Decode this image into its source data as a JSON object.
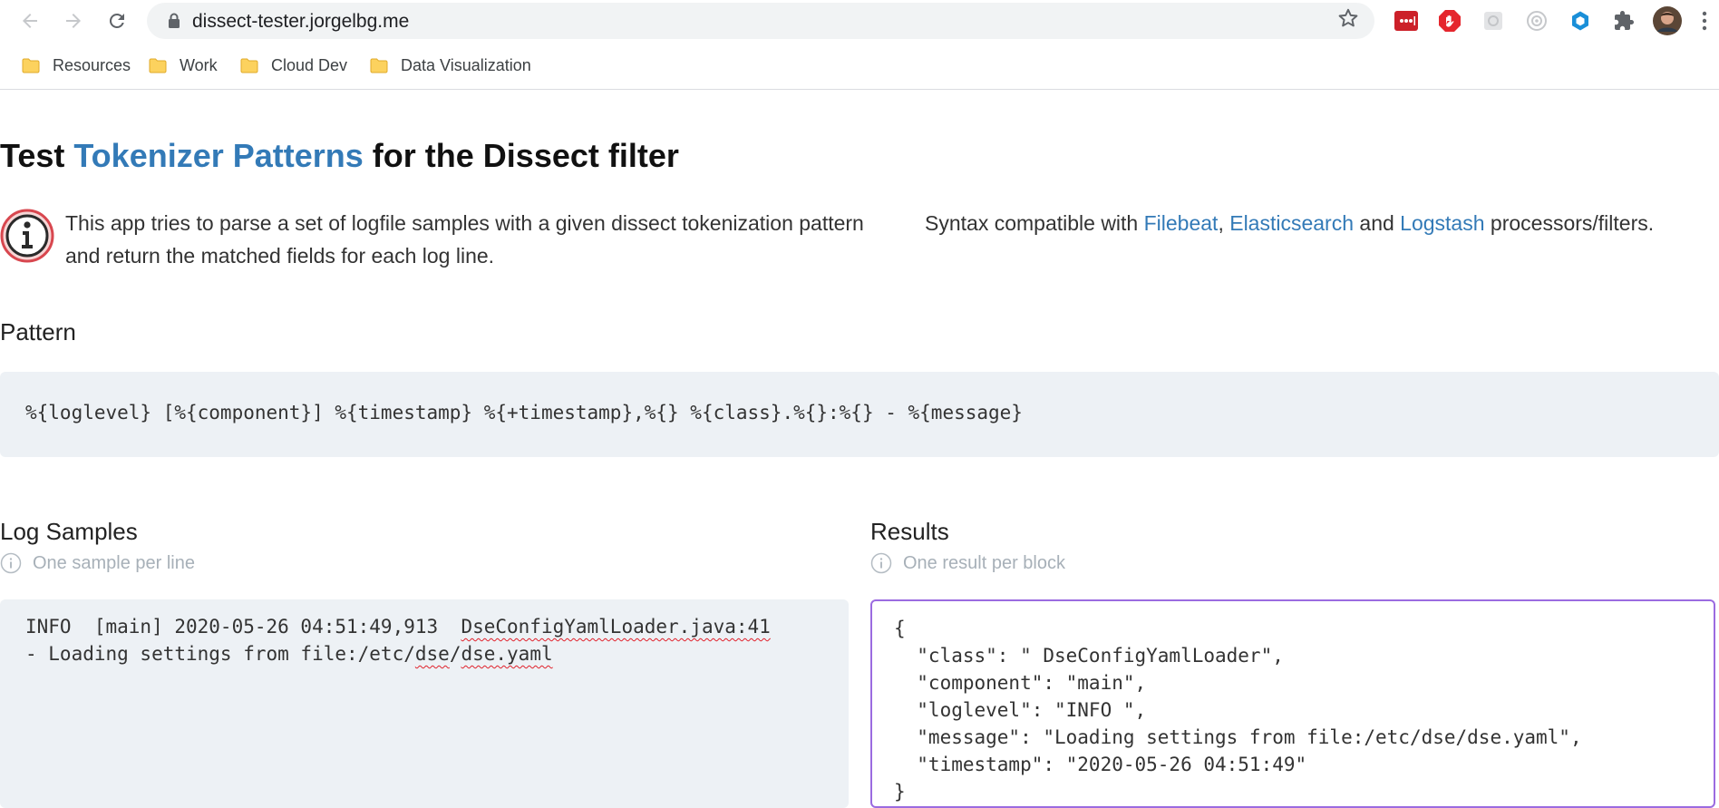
{
  "browser": {
    "url": "dissect-tester.jorgelbg.me",
    "bookmarks": [
      "Resources",
      "Work",
      "Cloud Dev",
      "Data Visualization"
    ],
    "icons": [
      "back-arrow-icon",
      "forward-arrow-icon",
      "reload-icon",
      "lock-icon",
      "star-icon",
      "extensions-icon",
      "kebab-menu-icon"
    ]
  },
  "header": {
    "title_prefix": "Test ",
    "title_link": "Tokenizer Patterns",
    "title_suffix": " for the Dissect filter"
  },
  "intro": {
    "description": "This app tries to parse a set of logfile samples with a given dissect tokenization pattern and return the matched fields for each log line.",
    "syntax_prefix": "Syntax compatible with ",
    "filebeat": "Filebeat",
    "comma": ", ",
    "elasticsearch": "Elasticsearch",
    "and": " and ",
    "logstash": "Logstash",
    "syntax_suffix": " processors/filters."
  },
  "pattern": {
    "heading": "Pattern",
    "value": "%{loglevel} [%{component}] %{timestamp} %{+timestamp},%{} %{class}.%{}:%{} - %{message}"
  },
  "samples": {
    "heading": "Log Samples",
    "hint": "One sample per line",
    "line1_a": "INFO  [main] 2020-05-26 04:51:49,913  ",
    "line1_b": "DseConfigYamlLoader.java:41",
    "line2_a": "- Loading settings from file:/etc/",
    "line2_b": "dse",
    "line2_c": "/",
    "line2_d": "dse.yaml"
  },
  "results": {
    "heading": "Results",
    "hint": "One result per block",
    "lines": [
      "{",
      "  \"class\": \" DseConfigYamlLoader\",",
      "  \"component\": \"main\",",
      "  \"loglevel\": \"INFO \",",
      "  \"message\": \"Loading settings from file:/etc/dse/dse.yaml\",",
      "  \"timestamp\": \"2020-05-26 04:51:49\"",
      "}"
    ]
  },
  "colors": {
    "link": "#337ab7",
    "code_bg": "#edf1f5",
    "results_border": "#9b6be0"
  }
}
